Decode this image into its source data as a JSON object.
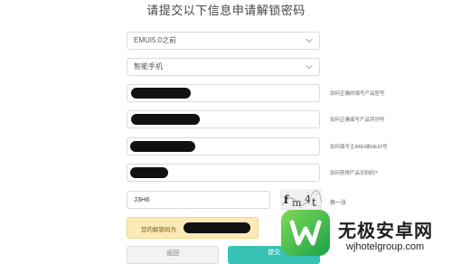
{
  "title": "请提交以下信息申请解锁密码",
  "form": {
    "os_select": {
      "value": "EMUI5.0之前"
    },
    "device_select": {
      "value": "智能手机"
    },
    "fields": [
      {
        "hint": "如何正确的填写产品型号"
      },
      {
        "hint": "如何正确填写产品序列号"
      },
      {
        "hint": "如何填写主IMEI或MEID号"
      },
      {
        "hint": "如何获得产品识别码?"
      }
    ],
    "captcha": {
      "value": "J3H6",
      "refresh_label": "换一张"
    },
    "result": {
      "label": "您的解锁码为"
    },
    "buttons": {
      "back": "返回",
      "submit": "提交"
    }
  },
  "watermark": {
    "title": "无极安卓网",
    "url": "wjhotelgroup.com"
  },
  "colors": {
    "accent": "#37c2b6",
    "result_bg": "#fbe9b6"
  }
}
